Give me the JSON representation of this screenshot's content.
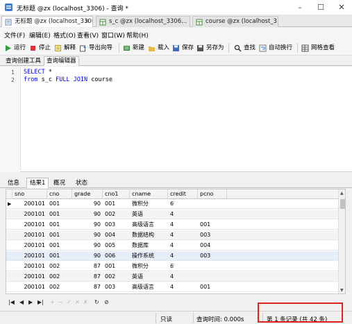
{
  "window": {
    "title": "无标题 @zx (localhost_3306) - 查询 *"
  },
  "doc_tabs": [
    {
      "label": "无标题 @zx (localhost_3306)..."
    },
    {
      "label": "s_c @zx (localhost_3306..."
    },
    {
      "label": "course @zx (localhost_3..."
    }
  ],
  "menu": [
    "文件(F)",
    "编辑(E)",
    "格式(O)",
    "查看(V)",
    "窗口(W)",
    "帮助(H)"
  ],
  "toolbar": {
    "run": "运行",
    "stop": "停止",
    "explain": "解释",
    "export": "导出向导",
    "new": "新建",
    "load": "载入",
    "save": "保存",
    "save_as": "另存为",
    "find": "查找",
    "wrap": "自动换行",
    "grid_view": "网格查看"
  },
  "sub_tabs": [
    "查询创建工具",
    "查询编辑器"
  ],
  "editor": {
    "line_numbers": [
      "1",
      "2"
    ],
    "line1": {
      "kw": "SELECT",
      "rest": " *"
    },
    "line2": {
      "kw1": "from",
      "mid1": " s_c ",
      "kw2": "FULL JOIN",
      "rest": " course"
    }
  },
  "result_tabs": [
    "信息",
    "结果1",
    "概况",
    "状态"
  ],
  "table": {
    "columns": [
      "sno",
      "cno",
      "grade",
      "cno1",
      "cname",
      "credit",
      "pcno"
    ],
    "rows": [
      [
        "200101",
        "001",
        "90",
        "001",
        "微积分",
        "6",
        ""
      ],
      [
        "200101",
        "001",
        "90",
        "002",
        "英语",
        "4",
        ""
      ],
      [
        "200101",
        "001",
        "90",
        "003",
        "高级语言",
        "4",
        "001"
      ],
      [
        "200101",
        "001",
        "90",
        "004",
        "数据结构",
        "4",
        "003"
      ],
      [
        "200101",
        "001",
        "90",
        "005",
        "数据库",
        "4",
        "004"
      ],
      [
        "200101",
        "001",
        "90",
        "006",
        "操作系统",
        "4",
        "003"
      ],
      [
        "200101",
        "002",
        "87",
        "001",
        "微积分",
        "6",
        ""
      ],
      [
        "200101",
        "002",
        "87",
        "002",
        "英语",
        "4",
        ""
      ],
      [
        "200101",
        "002",
        "87",
        "003",
        "高级语言",
        "4",
        "001"
      ]
    ]
  },
  "status": {
    "readonly": "只读",
    "query_time": "查询时间: 0.000s",
    "record": "第 1 条记录 (共 42 条)"
  },
  "colors": {
    "keyword": "#0000ff",
    "highlight_box": "#e0231f",
    "selected_row": "#e6eefa"
  }
}
